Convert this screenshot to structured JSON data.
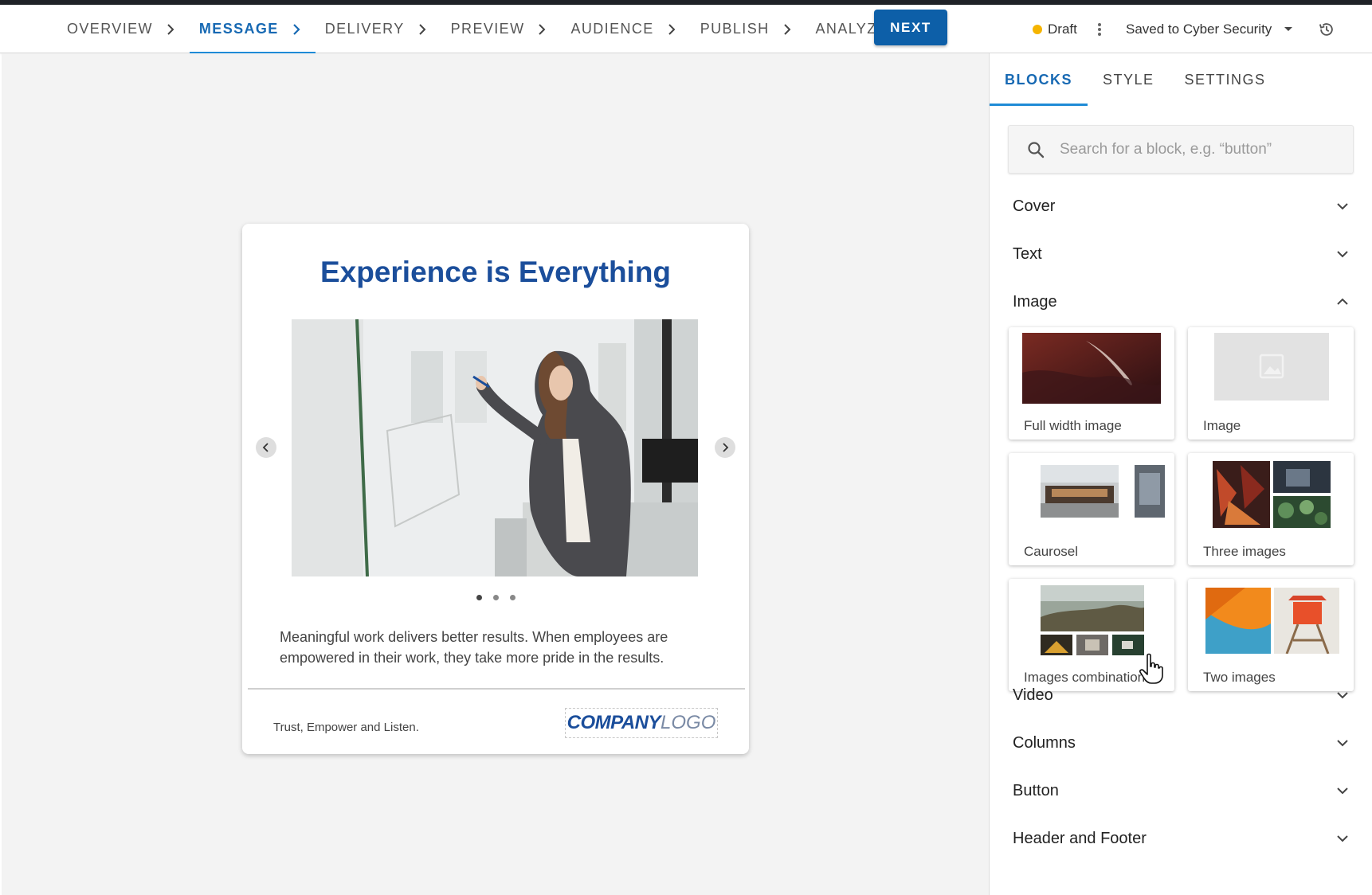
{
  "steps": [
    {
      "label": "OVERVIEW",
      "active": false
    },
    {
      "label": "MESSAGE",
      "active": true
    },
    {
      "label": "DELIVERY",
      "active": false
    },
    {
      "label": "PREVIEW",
      "active": false
    },
    {
      "label": "AUDIENCE",
      "active": false
    },
    {
      "label": "PUBLISH",
      "active": false
    },
    {
      "label": "ANALYZE",
      "active": false
    }
  ],
  "next_label": "NEXT",
  "status": {
    "label": "Draft",
    "color": "#f5b400"
  },
  "saved_label": "Saved to Cyber Security",
  "preview": {
    "title": "Experience is Everything",
    "body": "Meaningful work delivers better results. When employees are empowered in their work, they take more pride in the results.",
    "footer_text": "Trust, Empower and Listen.",
    "logo_bold": "COMPANY",
    "logo_light": "LOGO",
    "carousel_pages": 3,
    "carousel_active": 1
  },
  "panel": {
    "tabs": [
      {
        "label": "BLOCKS",
        "active": true
      },
      {
        "label": "STYLE",
        "active": false
      },
      {
        "label": "SETTINGS",
        "active": false
      }
    ],
    "search_placeholder": "Search for a block, e.g. “button”",
    "sections_top": [
      "Cover",
      "Text",
      "Image"
    ],
    "image_tiles": [
      "Full width image",
      "Image",
      "Caurosel",
      "Three images",
      "Images combination",
      "Two images"
    ],
    "sections_bottom": [
      "Video",
      "Columns",
      "Button",
      "Header and Footer"
    ]
  },
  "colors": {
    "accent": "#1769b3",
    "primary_button": "#0d5fa8",
    "title_blue": "#1b4e9b"
  }
}
